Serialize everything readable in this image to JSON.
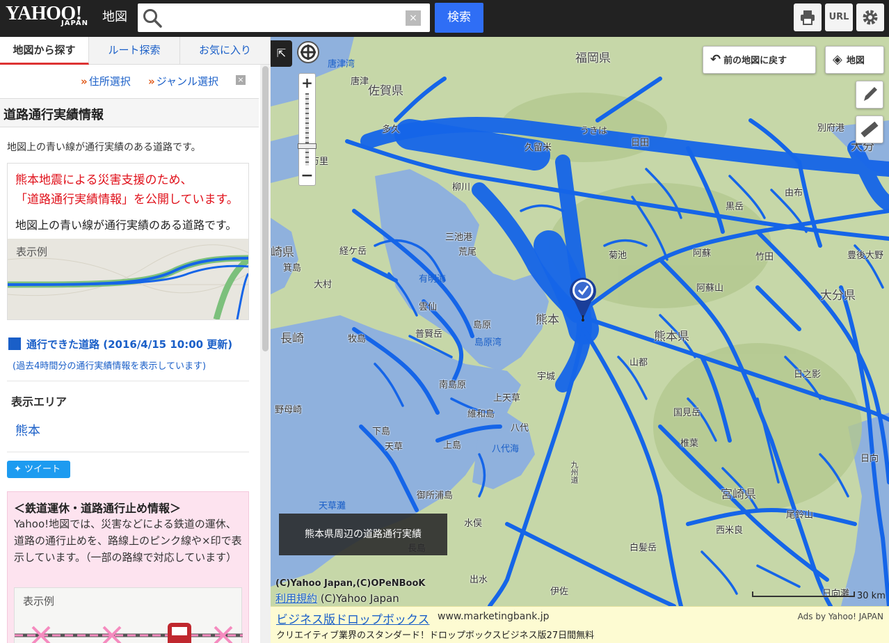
{
  "header": {
    "logo_text": "YAHOO!",
    "logo_sub": "JAPAN",
    "service": "地図",
    "search_value": "",
    "clear_label": "×",
    "search_button": "検索",
    "tools": [
      {
        "name": "print",
        "icon": "printer-icon",
        "label": ""
      },
      {
        "name": "url",
        "icon": "link-icon",
        "label": "URL"
      },
      {
        "name": "settings",
        "icon": "gear-icon",
        "label": ""
      }
    ]
  },
  "sidebar": {
    "tabs": [
      {
        "label": "地図から探す",
        "active": true
      },
      {
        "label": "ルート探索",
        "active": false
      },
      {
        "label": "お気に入り",
        "active": false
      }
    ],
    "select_links": [
      {
        "label": "住所選択"
      },
      {
        "label": "ジャンル選択"
      }
    ],
    "section_title": "道路通行実績情報",
    "description": "地図上の青い線が通行実績のある道路です。",
    "notice": {
      "red_line1": "熊本地震による災害支援のため、",
      "red_line2": "「道路通行実績情報」を公開しています。",
      "black_text": "地図上の青い線が通行実績のある道路です。",
      "legend_label": "表示例"
    },
    "passable_label": "通行できた道路 (2016/4/15 10:00 更新)",
    "passable_note": "(過去4時間分の通行実績情報を表示しています)",
    "area_label": "表示エリア",
    "area_value": "熊本",
    "tweet_label": "ツイート",
    "rail_box": {
      "title": "＜鉄道運休・道路通行止め情報＞",
      "body": "Yahoo!地図では、災害などによる鉄道の運休、道路の通行止めを、路線上のピンク線や×印で表示しています。（一部の路線で対応しています）",
      "legend_label": "表示例"
    }
  },
  "map": {
    "back_button": "前の地図に戻す",
    "layer_button": "地図",
    "caption": "熊本県周辺の道路通行実績",
    "copyright1": "(C)Yahoo Japan,(C)OPeNBooK",
    "terms_link": "利用規約",
    "copyright2": "(C)Yahoo Japan",
    "scale_label": "30 km",
    "zoom_in": "+",
    "zoom_out": "−",
    "labels": [
      {
        "text": "福岡県",
        "kind": "big"
      },
      {
        "text": "佐賀県",
        "kind": "big"
      },
      {
        "text": "熊本県",
        "kind": "big"
      },
      {
        "text": "大分県",
        "kind": "big"
      },
      {
        "text": "宮崎県",
        "kind": "big"
      },
      {
        "text": "崎県",
        "kind": "big"
      },
      {
        "text": "唐津湾",
        "kind": "sea"
      },
      {
        "text": "有明海",
        "kind": "sea"
      },
      {
        "text": "島原湾",
        "kind": "sea"
      },
      {
        "text": "八代海",
        "kind": "sea"
      },
      {
        "text": "天草灘",
        "kind": "sea"
      },
      {
        "text": "別府港",
        "kind": "sea"
      },
      {
        "text": "日向灘",
        "kind": "sea"
      },
      {
        "text": "久留米",
        "kind": "normal"
      },
      {
        "text": "伊万里",
        "kind": "normal"
      },
      {
        "text": "唐津",
        "kind": "normal"
      },
      {
        "text": "三池港",
        "kind": "normal"
      },
      {
        "text": "荒尾",
        "kind": "normal"
      },
      {
        "text": "経ケ岳",
        "kind": "normal"
      },
      {
        "text": "箕島",
        "kind": "normal"
      },
      {
        "text": "大村",
        "kind": "normal"
      },
      {
        "text": "長崎",
        "kind": "normal"
      },
      {
        "text": "牧島",
        "kind": "normal"
      },
      {
        "text": "雲仙",
        "kind": "normal"
      },
      {
        "text": "普賢岳",
        "kind": "normal"
      },
      {
        "text": "島原",
        "kind": "normal"
      },
      {
        "text": "熊本",
        "kind": "normal"
      },
      {
        "text": "菊池",
        "kind": "normal"
      },
      {
        "text": "阿蘇",
        "kind": "normal"
      },
      {
        "text": "阿蘇山",
        "kind": "normal"
      },
      {
        "text": "黒岳",
        "kind": "normal"
      },
      {
        "text": "竹田",
        "kind": "normal"
      },
      {
        "text": "豊後大野",
        "kind": "normal"
      },
      {
        "text": "由布",
        "kind": "normal"
      },
      {
        "text": "大分",
        "kind": "normal"
      },
      {
        "text": "日田",
        "kind": "normal"
      },
      {
        "text": "うきは",
        "kind": "normal"
      },
      {
        "text": "柳川",
        "kind": "normal"
      },
      {
        "text": "多久",
        "kind": "normal"
      },
      {
        "text": "宇城",
        "kind": "normal"
      },
      {
        "text": "上天草",
        "kind": "normal"
      },
      {
        "text": "南島原",
        "kind": "normal"
      },
      {
        "text": "維和島",
        "kind": "normal"
      },
      {
        "text": "八代",
        "kind": "normal"
      },
      {
        "text": "山都",
        "kind": "normal"
      },
      {
        "text": "日之影",
        "kind": "normal"
      },
      {
        "text": "国見岳",
        "kind": "normal"
      },
      {
        "text": "椎葉",
        "kind": "normal"
      },
      {
        "text": "下島",
        "kind": "normal"
      },
      {
        "text": "天草",
        "kind": "normal"
      },
      {
        "text": "上島",
        "kind": "normal"
      },
      {
        "text": "御所浦島",
        "kind": "normal"
      },
      {
        "text": "水俣",
        "kind": "normal"
      },
      {
        "text": "長島",
        "kind": "normal"
      },
      {
        "text": "出水",
        "kind": "normal"
      },
      {
        "text": "伊佐",
        "kind": "normal"
      },
      {
        "text": "白髪岳",
        "kind": "normal"
      },
      {
        "text": "西米良",
        "kind": "normal"
      },
      {
        "text": "尾鈴山",
        "kind": "normal"
      },
      {
        "text": "日向",
        "kind": "normal"
      },
      {
        "text": "野母崎",
        "kind": "normal"
      },
      {
        "text": "九州道",
        "kind": "normal"
      }
    ]
  },
  "ad": {
    "title": "ビジネス版ドロップボックス",
    "url": "www.marketingbank.jp",
    "provider": "Ads by Yahoo! JAPAN",
    "description": "クリエイティブ業界のスタンダード！ドロップボックスビジネス版27日間無料"
  },
  "colors": {
    "header_bg": "#222222",
    "accent_blue": "#2f6ef5",
    "link_blue": "#1a5fc8",
    "road_blue": "#1565e8",
    "alert_red": "#e0101a",
    "rail_pink": "#fde3ef",
    "sea": "#8fb1dd",
    "land": "#c6d7a8"
  }
}
